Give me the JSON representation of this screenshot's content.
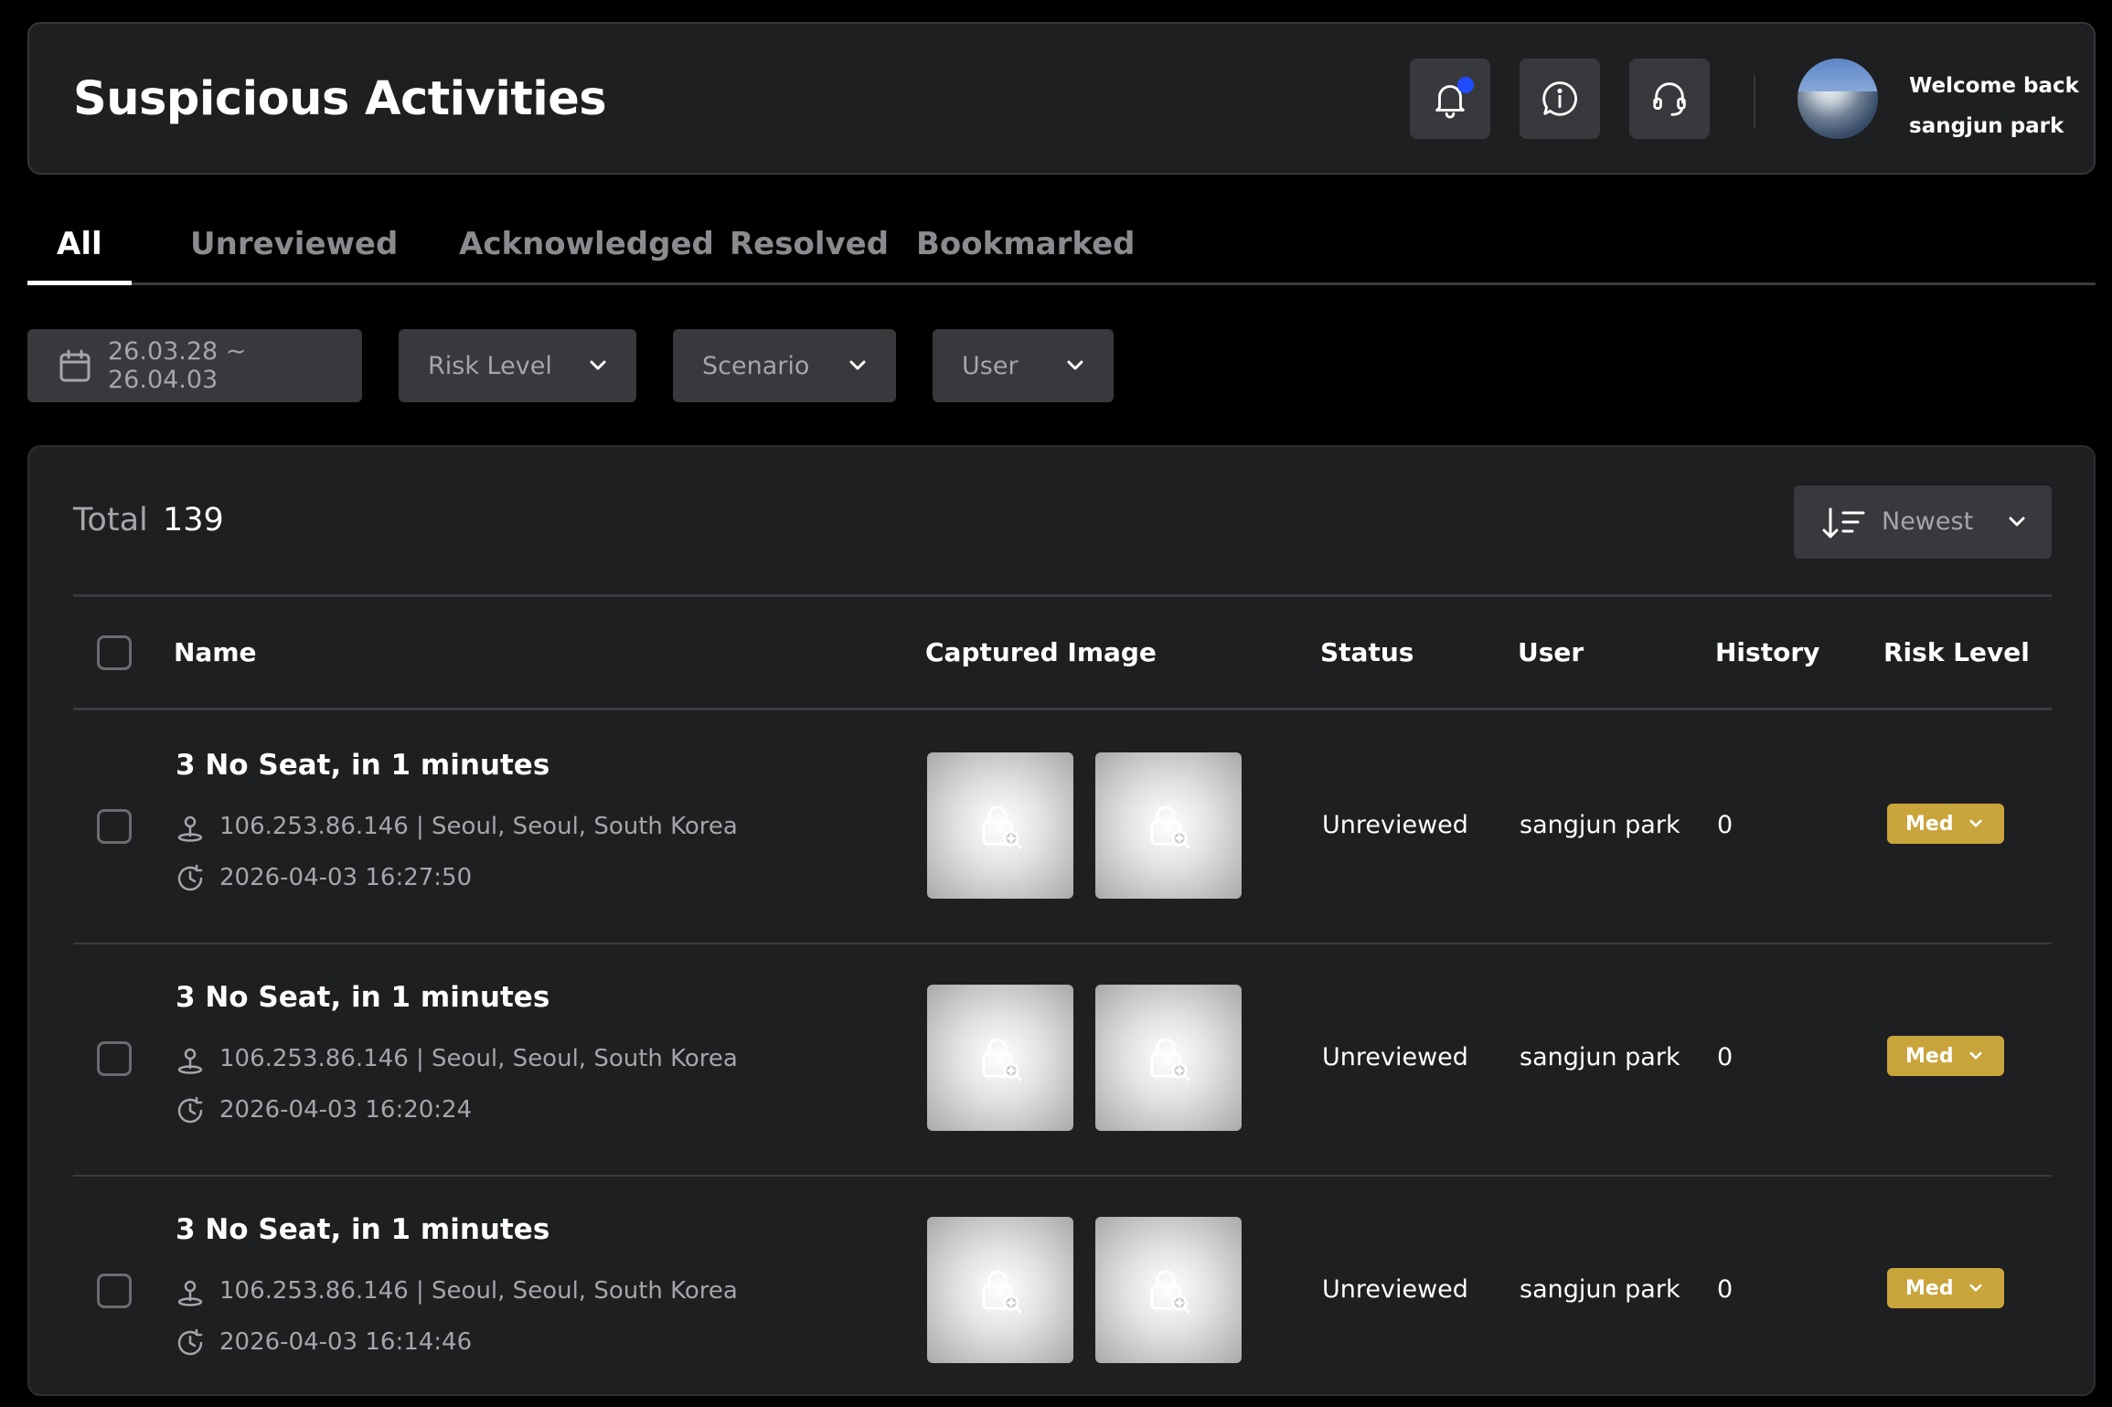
{
  "header": {
    "title": "Suspicious Activities",
    "welcome_line1": "Welcome back",
    "welcome_line2": "sangjun park"
  },
  "tabs": [
    {
      "label": "All",
      "active": true
    },
    {
      "label": "Unreviewed",
      "active": false
    },
    {
      "label": "Acknowledged",
      "active": false
    },
    {
      "label": "Resolved",
      "active": false
    },
    {
      "label": "Bookmarked",
      "active": false
    }
  ],
  "filters": {
    "date_range": "26.03.28 ~ 26.04.03",
    "risk_level": "Risk Level",
    "scenario": "Scenario",
    "user": "User"
  },
  "summary": {
    "total_label": "Total",
    "total_value": "139",
    "sort_label": "Newest"
  },
  "table": {
    "columns": [
      "Name",
      "Captured Image",
      "Status",
      "User",
      "History",
      "Risk Level"
    ],
    "rows": [
      {
        "name": "3 No Seat, in 1 minutes",
        "location": "106.253.86.146 | Seoul, Seoul, South Korea",
        "time": "2026-04-03 16:27:50",
        "status": "Unreviewed",
        "user": "sangjun park",
        "history": "0",
        "risk": "Med"
      },
      {
        "name": "3 No Seat, in 1 minutes",
        "location": "106.253.86.146 | Seoul, Seoul, South Korea",
        "time": "2026-04-03 16:20:24",
        "status": "Unreviewed",
        "user": "sangjun park",
        "history": "0",
        "risk": "Med"
      },
      {
        "name": "3 No Seat, in 1 minutes",
        "location": "106.253.86.146 | Seoul, Seoul, South Korea",
        "time": "2026-04-03 16:14:46",
        "status": "Unreviewed",
        "user": "sangjun park",
        "history": "0",
        "risk": "Med"
      }
    ]
  },
  "colors": {
    "background": "#000000",
    "surface": "#1e1f21",
    "control": "#38393c",
    "notification_dot": "#1f4cff",
    "risk_med": "#c9a43b"
  },
  "icons": [
    "bell-icon",
    "info-icon",
    "headset-icon",
    "calendar-icon",
    "chevron-down-icon",
    "sort-icon",
    "location-icon",
    "clock-icon",
    "locked-image-icon"
  ]
}
